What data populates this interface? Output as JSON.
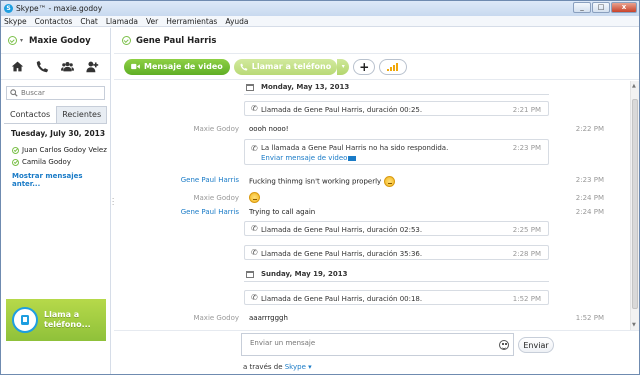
{
  "window": {
    "title": "Skype™ - maxie.godoy",
    "controls": [
      "_",
      "□",
      "x"
    ]
  },
  "menu": [
    "Skype",
    "Contactos",
    "Chat",
    "Llamada",
    "Ver",
    "Herramientas",
    "Ayuda"
  ],
  "sidebar": {
    "profile_name": "Maxie Godoy",
    "search_placeholder": "Buscar",
    "tabs": [
      "Contactos",
      "Recientes"
    ],
    "date_header": "Tuesday, July 30, 2013",
    "contacts": [
      "Juan Carlos Godoy Velez",
      "Camila Godoy"
    ],
    "show_more": "Mostrar mensajes anter...",
    "promo": {
      "line1": "Llama a",
      "line2": "teléfono..."
    }
  },
  "conversation": {
    "contact_name": "Gene Paul Harris",
    "video_button": "Mensaje de video",
    "call_button": "Llamar a teléfono",
    "items": [
      {
        "kind": "day",
        "label": "Monday, May 13, 2013"
      },
      {
        "kind": "call",
        "text": "Llamada de Gene Paul Harris, duración 00:25.",
        "time": "2:21 PM"
      },
      {
        "kind": "msg",
        "sender": "Maxie Godoy",
        "text": "oooh nooo!",
        "time": "2:22 PM"
      },
      {
        "kind": "call2",
        "text": "La llamada a Gene Paul Harris no ha sido respondida.",
        "link": "Enviar mensaje de video",
        "time": "2:23 PM"
      },
      {
        "kind": "msg",
        "sender": "Gene Paul Harris",
        "text": "Fucking thinmg isn't working properly",
        "time": "2:23 PM",
        "emoji": true
      },
      {
        "kind": "msg",
        "sender": "Maxie Godoy",
        "text": "",
        "time": "2:24 PM",
        "emoji": true
      },
      {
        "kind": "msg",
        "sender": "Gene Paul Harris",
        "text": "Trying to call again",
        "time": "2:24 PM"
      },
      {
        "kind": "call",
        "text": "Llamada de Gene Paul Harris, duración 02:53.",
        "time": "2:25 PM"
      },
      {
        "kind": "call",
        "text": "Llamada de Gene Paul Harris, duración 35:36.",
        "time": "2:28 PM"
      },
      {
        "kind": "day",
        "label": "Sunday, May 19, 2013"
      },
      {
        "kind": "call",
        "text": "Llamada de Gene Paul Harris, duración 00:18.",
        "time": "1:52 PM"
      },
      {
        "kind": "msg",
        "sender": "Maxie Godoy",
        "text": "aaarrrgggh",
        "time": "1:52 PM"
      }
    ],
    "message_placeholder": "Enviar un mensaje",
    "send_button": "Enviar",
    "via_prefix": "a través de",
    "via_link": "Skype"
  },
  "colors": {
    "accent_green": "#5fae25",
    "link_blue": "#1a7bc7",
    "status_green": "#7cc04a"
  }
}
